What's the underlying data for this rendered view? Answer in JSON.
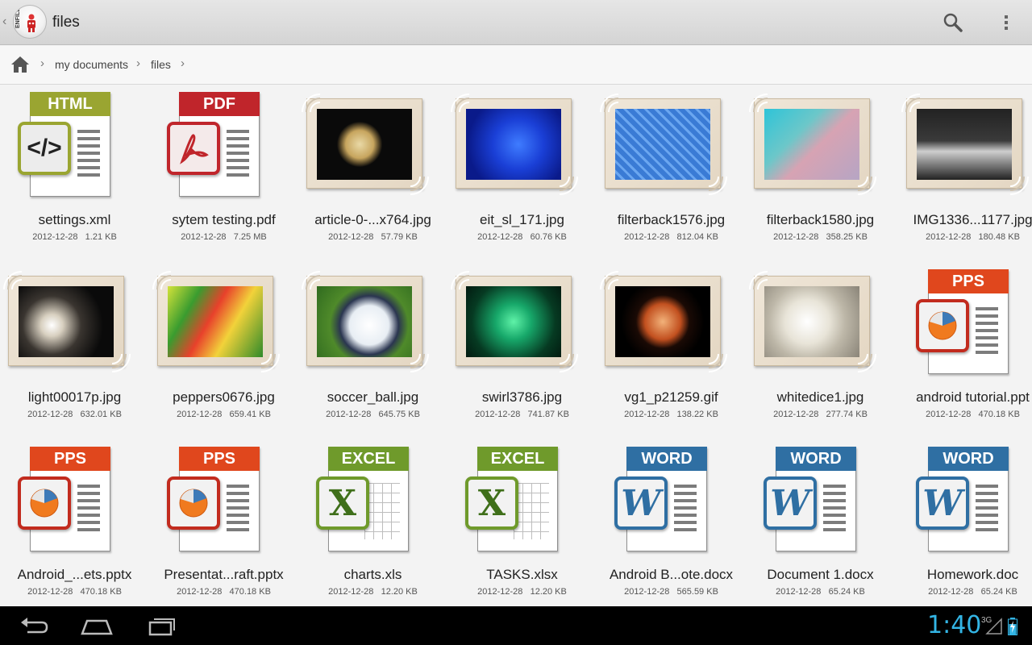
{
  "actionbar": {
    "app_logo_text": "ENFILE",
    "title": "files",
    "search_icon": "search-icon",
    "overflow_icon": "overflow-menu-icon"
  },
  "breadcrumb": {
    "home_icon": "home-icon",
    "items": [
      "my documents",
      "files"
    ]
  },
  "files": [
    {
      "name": "settings.xml",
      "date": "2012-12-28",
      "size": "1.21 KB",
      "kind": "HTML"
    },
    {
      "name": "sytem testing.pdf",
      "date": "2012-12-28",
      "size": "7.25 MB",
      "kind": "PDF"
    },
    {
      "name": "article-0-...x764.jpg",
      "date": "2012-12-28",
      "size": "57.79 KB",
      "kind": "photo"
    },
    {
      "name": "eit_sl_171.jpg",
      "date": "2012-12-28",
      "size": "60.76 KB",
      "kind": "photo"
    },
    {
      "name": "filterback1576.jpg",
      "date": "2012-12-28",
      "size": "812.04 KB",
      "kind": "photo"
    },
    {
      "name": "filterback1580.jpg",
      "date": "2012-12-28",
      "size": "358.25 KB",
      "kind": "photo"
    },
    {
      "name": "IMG1336...1177.jpg",
      "date": "2012-12-28",
      "size": "180.48 KB",
      "kind": "photo"
    },
    {
      "name": "light00017p.jpg",
      "date": "2012-12-28",
      "size": "632.01 KB",
      "kind": "photo"
    },
    {
      "name": "peppers0676.jpg",
      "date": "2012-12-28",
      "size": "659.41 KB",
      "kind": "photo"
    },
    {
      "name": "soccer_ball.jpg",
      "date": "2012-12-28",
      "size": "645.75 KB",
      "kind": "photo"
    },
    {
      "name": "swirl3786.jpg",
      "date": "2012-12-28",
      "size": "741.87 KB",
      "kind": "photo"
    },
    {
      "name": "vg1_p21259.gif",
      "date": "2012-12-28",
      "size": "138.22 KB",
      "kind": "photo"
    },
    {
      "name": "whitedice1.jpg",
      "date": "2012-12-28",
      "size": "277.74 KB",
      "kind": "photo"
    },
    {
      "name": "android tutorial.ppt",
      "date": "2012-12-28",
      "size": "470.18 KB",
      "kind": "PPS"
    },
    {
      "name": "Android_...ets.pptx",
      "date": "2012-12-28",
      "size": "470.18 KB",
      "kind": "PPS"
    },
    {
      "name": "Presentat...raft.pptx",
      "date": "2012-12-28",
      "size": "470.18 KB",
      "kind": "PPS"
    },
    {
      "name": "charts.xls",
      "date": "2012-12-28",
      "size": "12.20 KB",
      "kind": "EXCEL"
    },
    {
      "name": "TASKS.xlsx",
      "date": "2012-12-28",
      "size": "12.20 KB",
      "kind": "EXCEL"
    },
    {
      "name": "Android B...ote.docx",
      "date": "2012-12-28",
      "size": "565.59 KB",
      "kind": "WORD"
    },
    {
      "name": "Document 1.docx",
      "date": "2012-12-28",
      "size": "65.24 KB",
      "kind": "WORD"
    },
    {
      "name": "Homework.doc",
      "date": "2012-12-28",
      "size": "65.24 KB",
      "kind": "WORD"
    }
  ],
  "doc_labels": {
    "HTML": "HTML",
    "PDF": "PDF",
    "PPS": "PPS",
    "EXCEL": "EXCEL",
    "WORD": "WORD"
  },
  "doc_colors": {
    "HTML": "#9aa531",
    "PDF": "#c0252b",
    "PPS": "#e0471d",
    "EXCEL": "#6f9a2b",
    "WORD": "#2f6fa3"
  },
  "badge_glyphs": {
    "HTML": "</>",
    "PDF": "pdf-acrobat-icon",
    "PPS": "pie-chart-icon",
    "EXCEL": "X",
    "WORD": "W"
  },
  "navbar": {
    "back_icon": "back-icon",
    "home_icon": "home-nav-icon",
    "recents_icon": "recent-apps-icon",
    "time": "1:40",
    "network": "3G",
    "signal_icon": "signal-icon",
    "battery_icon": "battery-charging-icon"
  },
  "colors": {
    "accent": "#33b5e5"
  }
}
